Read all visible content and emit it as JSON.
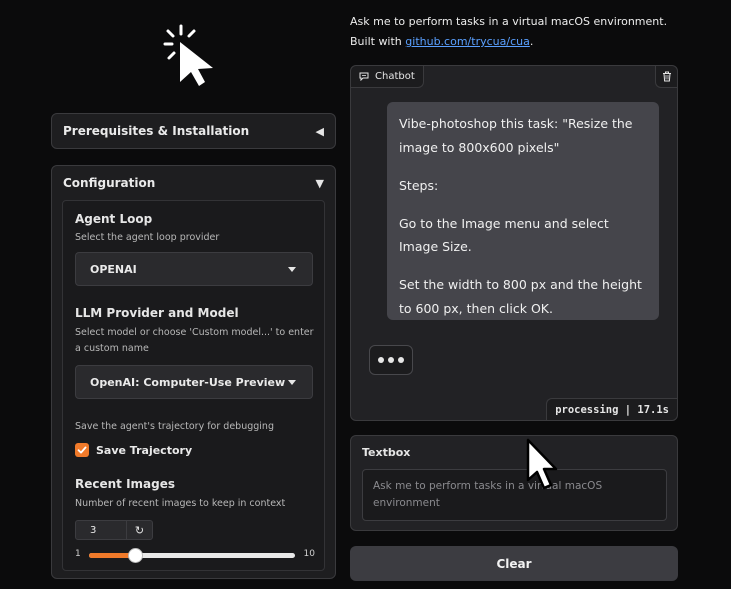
{
  "intro": {
    "line1": "Ask me to perform tasks in a virtual macOS environment.",
    "built_with_prefix": "Built with ",
    "built_with_link": "github.com/trycua/cua",
    "built_with_suffix": "."
  },
  "sidebar": {
    "prereq": {
      "title": "Prerequisites & Installation",
      "arrow": "◀"
    },
    "config": {
      "title": "Configuration",
      "arrow": "▼",
      "agent_loop": {
        "label": "Agent Loop",
        "description": "Select the agent loop provider",
        "value": "OPENAI"
      },
      "llm": {
        "label": "LLM Provider and Model",
        "description": "Select model or choose 'Custom model...' to enter a custom name",
        "value": "OpenAI: Computer-Use Preview"
      },
      "trajectory": {
        "description": "Save the agent's trajectory for debugging",
        "label": "Save Trajectory",
        "checked": true
      },
      "recent_images": {
        "label": "Recent Images",
        "description": "Number of recent images to keep in context",
        "value": "3",
        "min": "1",
        "max": "10",
        "level": 3
      }
    }
  },
  "chatbot": {
    "label": "Chatbot",
    "message": {
      "p1": "Vibe-photoshop this task: \"Resize the image to 800x600 pixels\"",
      "p2": "Steps:",
      "p3": "Go to the Image menu and select Image Size.",
      "p4": "Set the width to 800 px and the height to 600 px, then click OK."
    },
    "status": "processing | 17.1s"
  },
  "textbox": {
    "label": "Textbox",
    "placeholder": "Ask me to perform tasks in a virtual macOS environment"
  },
  "clear_button": {
    "label": "Clear"
  },
  "colors": {
    "accent": "#f07a2a",
    "link": "#5aa0ff",
    "background": "#0b0b0c"
  },
  "icons": {
    "logo": "cursor-click-icon",
    "chat": "chat-bubble-icon",
    "trash": "trash-icon",
    "reset": "reset-icon",
    "pointer": "mouse-pointer-icon"
  }
}
